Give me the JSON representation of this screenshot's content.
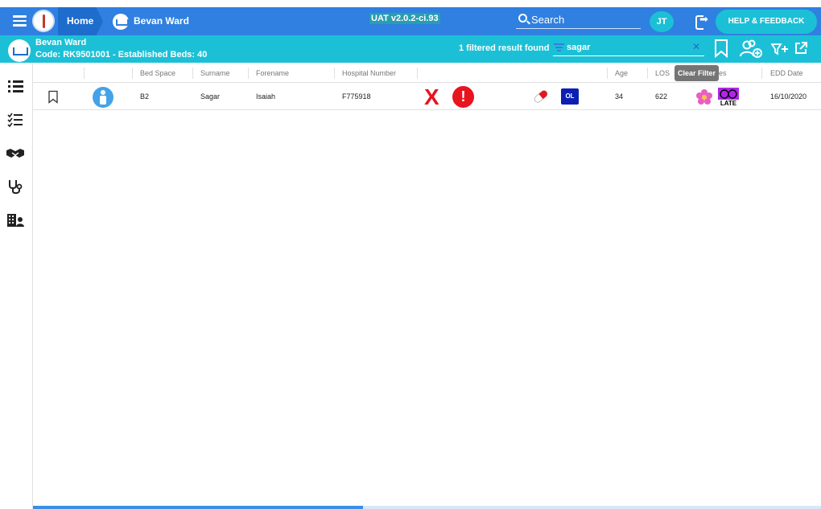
{
  "header": {
    "home_label": "Home",
    "ward_label": "Bevan Ward",
    "version": "UAT v2.0.2-ci.93",
    "search_label": "Search",
    "user_initials": "JT",
    "help_label": "HELP & FEEDBACK"
  },
  "ward": {
    "name": "Bevan Ward",
    "code_line": "Code: RK9501001 - Established Beds: 40",
    "filter_result": "1 filtered result found",
    "filter_value": "sagar",
    "clear_filter_tooltip": "Clear Filter"
  },
  "table": {
    "columns": [
      "Bed Space",
      "Surname",
      "Forename",
      "Hospital Number",
      "Age",
      "LOS",
      "Notes",
      "EDD Date"
    ],
    "visible_column_fragment": "es",
    "rows": [
      {
        "bed_space": "B2",
        "surname": "Sagar",
        "forename": "Isaiah",
        "hospital_number": "F775918",
        "age": "34",
        "los": "622",
        "ol_badge": "OL",
        "late_label": "LATE",
        "edd_date": "16/10/2020"
      }
    ]
  },
  "colors": {
    "primary": "#2f80e0",
    "accent": "#1cc0d6",
    "alert": "#e8141e",
    "badge": "#0b1fb5",
    "late": "#b026e8"
  },
  "icons": {
    "nav": [
      "list-icon",
      "checklist-icon",
      "handshake-icon",
      "stethoscope-icon",
      "building-user-icon"
    ]
  }
}
